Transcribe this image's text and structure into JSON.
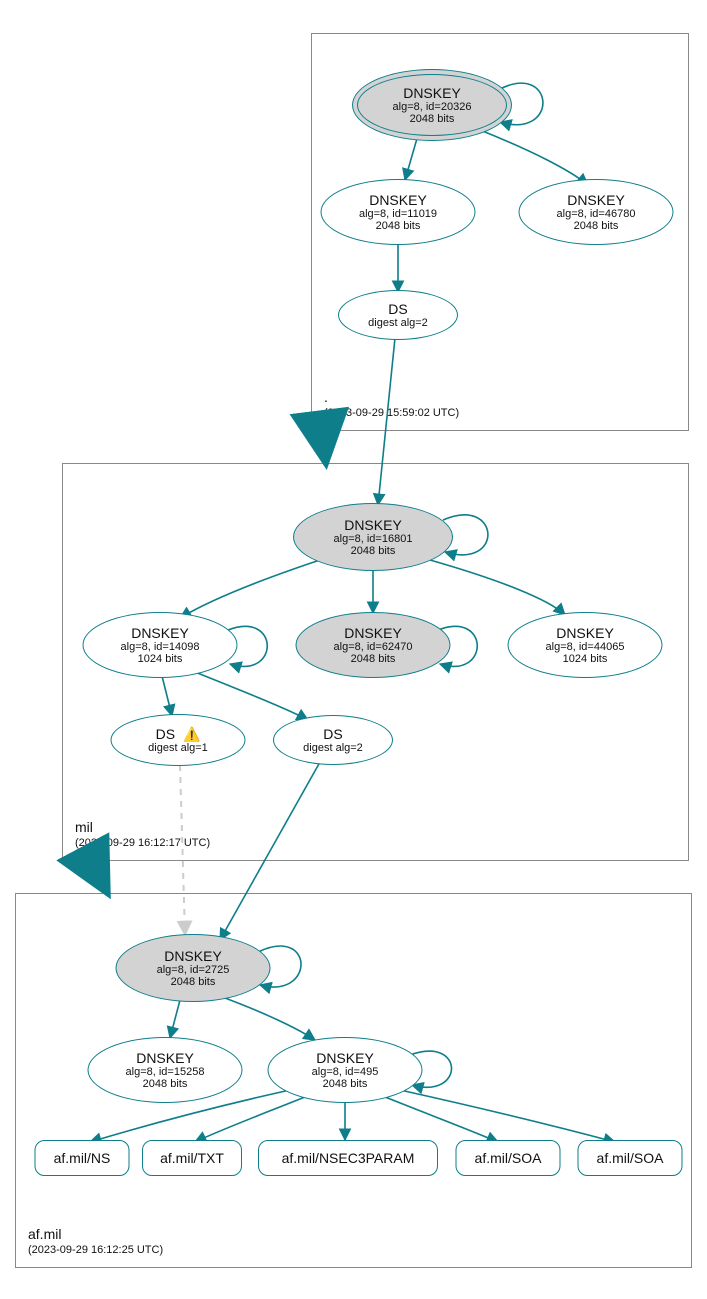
{
  "colors": {
    "stroke": "#0d7e8a",
    "dashed": "#cccccc",
    "zone_border": "#888888",
    "node_fill_shaded": "#d3d3d3"
  },
  "zones": {
    "root": {
      "name": ".",
      "timestamp": "(2023-09-29 15:59:02 UTC)"
    },
    "mil": {
      "name": "mil",
      "timestamp": "(2023-09-29 16:12:17 UTC)"
    },
    "afmil": {
      "name": "af.mil",
      "timestamp": "(2023-09-29 16:12:25 UTC)"
    }
  },
  "nodes": {
    "root_ksk": {
      "title": "DNSKEY",
      "sub": "alg=8, id=20326",
      "bits": "2048 bits"
    },
    "root_zsk1": {
      "title": "DNSKEY",
      "sub": "alg=8, id=11019",
      "bits": "2048 bits"
    },
    "root_zsk2": {
      "title": "DNSKEY",
      "sub": "alg=8, id=46780",
      "bits": "2048 bits"
    },
    "root_ds": {
      "title": "DS",
      "sub": "digest alg=2"
    },
    "mil_ksk": {
      "title": "DNSKEY",
      "sub": "alg=8, id=16801",
      "bits": "2048 bits"
    },
    "mil_zsk1": {
      "title": "DNSKEY",
      "sub": "alg=8, id=14098",
      "bits": "1024 bits"
    },
    "mil_zsk2": {
      "title": "DNSKEY",
      "sub": "alg=8, id=62470",
      "bits": "2048 bits"
    },
    "mil_zsk3": {
      "title": "DNSKEY",
      "sub": "alg=8, id=44065",
      "bits": "1024 bits"
    },
    "mil_ds1": {
      "title": "DS",
      "sub": "digest alg=1",
      "warn": "⚠️"
    },
    "mil_ds2": {
      "title": "DS",
      "sub": "digest alg=2"
    },
    "af_ksk": {
      "title": "DNSKEY",
      "sub": "alg=8, id=2725",
      "bits": "2048 bits"
    },
    "af_zsk1": {
      "title": "DNSKEY",
      "sub": "alg=8, id=15258",
      "bits": "2048 bits"
    },
    "af_zsk2": {
      "title": "DNSKEY",
      "sub": "alg=8, id=495",
      "bits": "2048 bits"
    },
    "rr_ns": {
      "title": "af.mil/NS"
    },
    "rr_txt": {
      "title": "af.mil/TXT"
    },
    "rr_nsec3": {
      "title": "af.mil/NSEC3PARAM"
    },
    "rr_soa1": {
      "title": "af.mil/SOA"
    },
    "rr_soa2": {
      "title": "af.mil/SOA"
    }
  }
}
